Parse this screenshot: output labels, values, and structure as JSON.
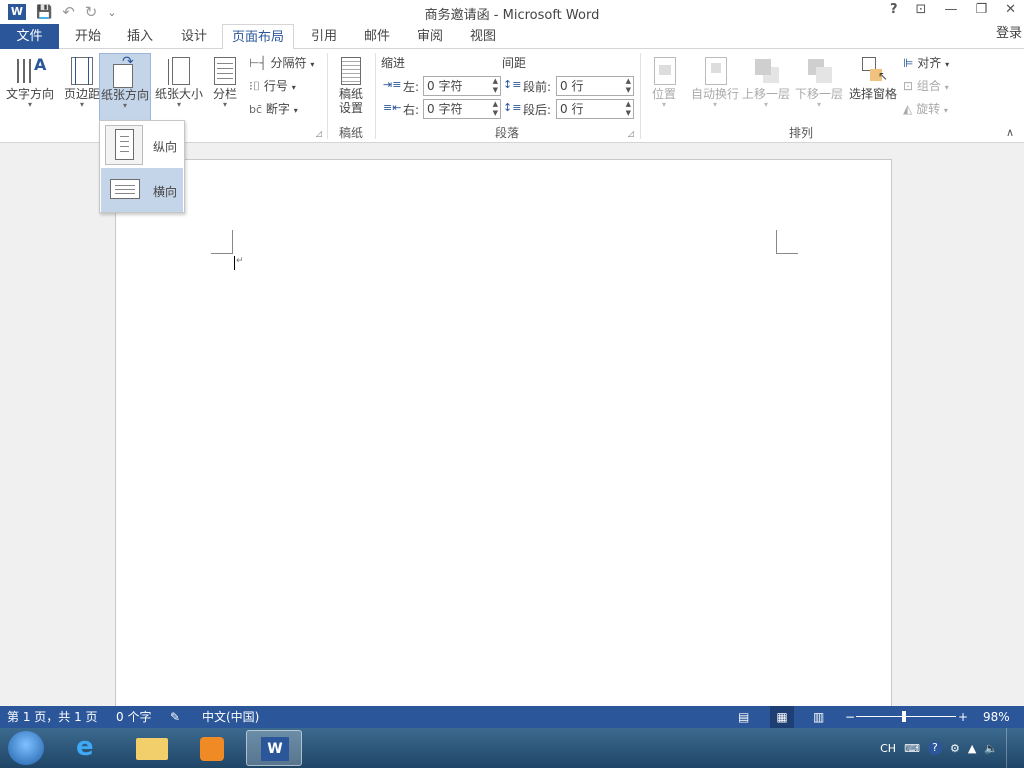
{
  "titlebar": {
    "title": "商务邀请函 - Microsoft Word",
    "help": "?",
    "ribbon_display": "⊡",
    "minimize": "—",
    "restore": "❐",
    "close": "✕",
    "undo": "↶",
    "redo": "↻",
    "save": "💾",
    "qat_more": "⌄"
  },
  "tabs": {
    "file": "文件",
    "items": [
      "开始",
      "插入",
      "设计",
      "页面布局",
      "引用",
      "邮件",
      "审阅",
      "视图"
    ],
    "active_index": 3,
    "signin": "登录"
  },
  "ribbon": {
    "page_setup": {
      "text_direction": "文字方向",
      "margins": "页边距",
      "orientation": "纸张方向",
      "size": "纸张大小",
      "columns": "分栏",
      "breaks": "分隔符",
      "line_numbers": "行号",
      "hyphenation": "断字"
    },
    "manuscript": {
      "button_line1": "稿纸",
      "button_line2": "设置",
      "group_label": "稿纸"
    },
    "paragraph": {
      "indent_header": "缩进",
      "spacing_header": "间距",
      "left_label": "左:",
      "right_label": "右:",
      "left_value": "0 字符",
      "right_value": "0 字符",
      "before_label": "段前:",
      "after_label": "段后:",
      "before_value": "0 行",
      "after_value": "0 行",
      "group_label": "段落"
    },
    "arrange": {
      "position": "位置",
      "wrap_text": "自动换行",
      "bring_forward": "上移一层",
      "send_backward": "下移一层",
      "selection_pane": "选择窗格",
      "align": "对齐",
      "group": "组合",
      "rotate": "旋转",
      "group_label": "排列"
    }
  },
  "orientation_menu": {
    "portrait": "纵向",
    "landscape": "横向"
  },
  "statusbar": {
    "page": "第 1 页，共 1 页",
    "words": "0 个字",
    "language": "中文(中国)",
    "zoom": "98%",
    "zoom_out": "−",
    "zoom_in": "+"
  },
  "taskbar": {
    "ime": "CH",
    "help": "?"
  },
  "colors": {
    "accent": "#2b579a",
    "pressed": "#c5d5e9"
  }
}
